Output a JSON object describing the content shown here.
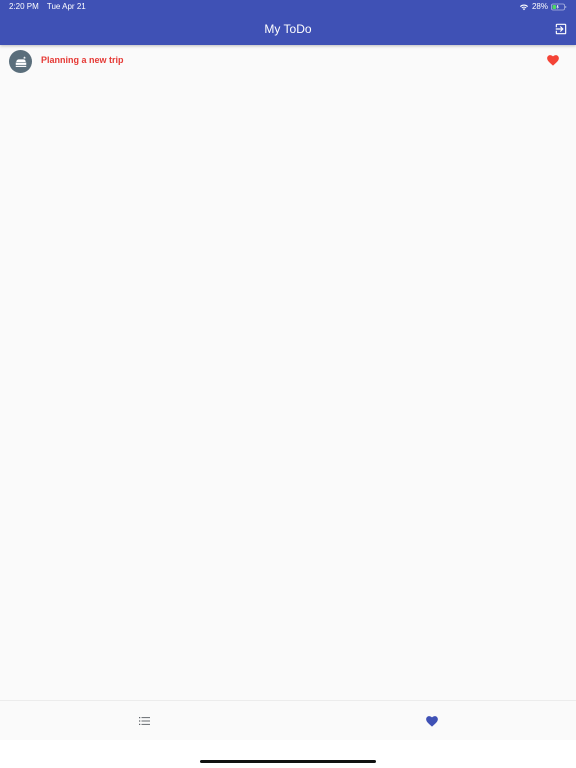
{
  "status_bar": {
    "time": "2:20 PM",
    "date": "Tue Apr 21",
    "battery_percent": "28%",
    "wifi_icon": "wifi-icon",
    "battery_icon": "battery-icon"
  },
  "header": {
    "title": "My ToDo",
    "logout_icon": "logout-icon",
    "color": "#3f51b5"
  },
  "todos": [
    {
      "title": "Planning a new trip",
      "icon": "hotel-icon",
      "favorite": true,
      "title_color": "#e53935"
    }
  ],
  "bottom_nav": {
    "items": [
      {
        "icon": "list-icon",
        "active": false
      },
      {
        "icon": "heart-icon",
        "active": true
      }
    ],
    "active_color": "#3f51b5"
  }
}
